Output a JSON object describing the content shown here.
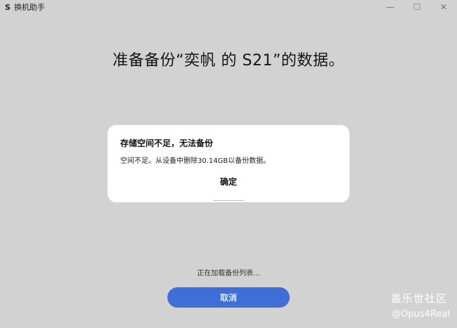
{
  "window": {
    "icon_glyph": "S",
    "title": "换机助手",
    "controls": {
      "minimize": "—",
      "maximize": "☐",
      "close": "✕"
    }
  },
  "headline": "准备备份“奕帆 的 S21”的数据。",
  "dialog": {
    "title": "存储空间不足，无法备份",
    "message": "空间不足。从设备中删除30.14GB以备份数据。",
    "ok_label": "确定"
  },
  "status": {
    "loading_text": "正在加载备份列表..."
  },
  "cancel_label": "取消",
  "watermark": {
    "line1": "盖乐世社区",
    "line2": "@Opus4Real"
  },
  "colors": {
    "background": "#d2d2d2",
    "primary_button": "#3f6ed6",
    "dialog": "#ffffff"
  }
}
